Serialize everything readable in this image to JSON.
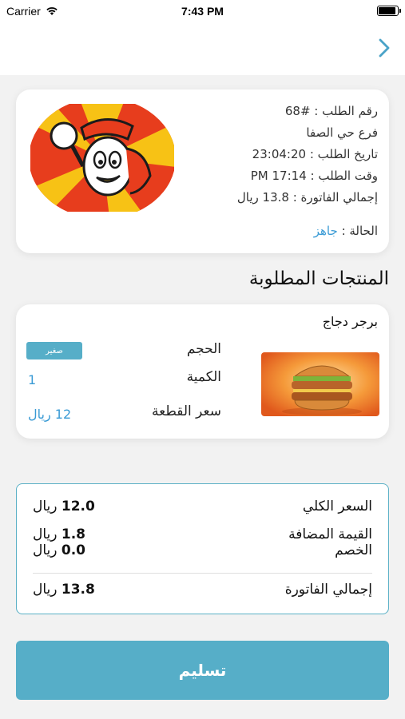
{
  "status_bar": {
    "carrier": "Carrier",
    "time": "7:43 PM"
  },
  "order": {
    "number": "رقم الطلب : #68",
    "branch": "فرع حي الصفا",
    "date": "تاريخ الطلب : 23:04:20",
    "time": "وقت الطلب : 17:14 PM",
    "invoice_total": "إجمالي الفاتورة : 13.8 ريال",
    "status_label": "الحالة :",
    "status_value": "جاهز"
  },
  "section_title": "المنتجات المطلوبة",
  "product": {
    "name": "برجر دجاج",
    "size_label": "الحجم",
    "size_value": "صغير",
    "quantity_label": "الكمية",
    "quantity_value": "1",
    "unit_price_label": "سعر القطعة",
    "unit_price_value": "12 ريال"
  },
  "summary": {
    "subtotal_label": "السعر الكلي",
    "subtotal_value": "12.0",
    "vat_label": "القيمة المضافة",
    "vat_value": "1.8",
    "discount_label": "الخصم",
    "discount_value": "0.0",
    "total_label": "إجمالي الفاتورة",
    "total_value": "13.8",
    "currency": "ريال"
  },
  "deliver_button": "تسليم",
  "icons": {
    "wifi": "wifi-icon",
    "battery": "battery-icon",
    "back": "chevron-right-icon"
  },
  "colors": {
    "accent": "#56aec8",
    "status": "#3a9bd5"
  }
}
